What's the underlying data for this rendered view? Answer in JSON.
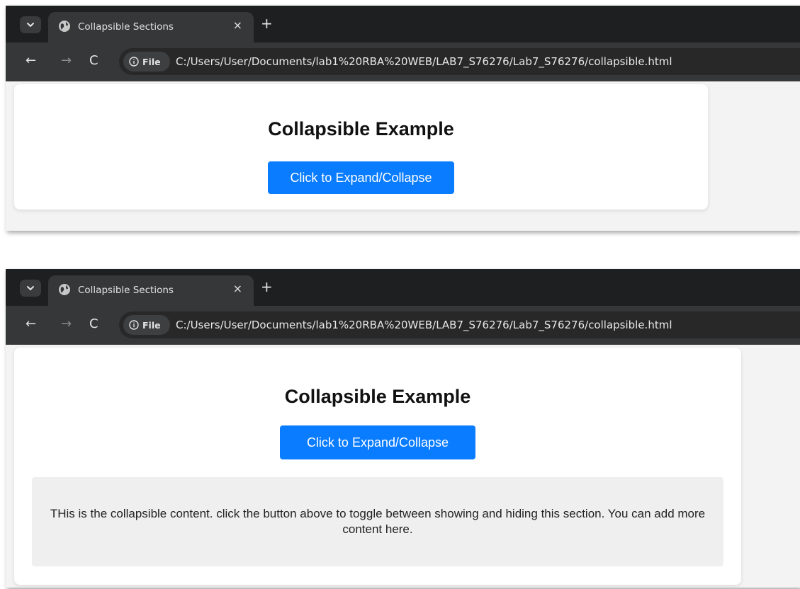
{
  "browser": {
    "tab_title": "Collapsible Sections",
    "tab_close": "×",
    "new_tab": "+",
    "nav_back": "←",
    "nav_forward": "→",
    "nav_reload": "C",
    "file_chip": "File",
    "url": "C:/Users/User/Documents/lab1%20RBA%20WEB/LAB7_S76276/Lab7_S76276/collapsible.html"
  },
  "page": {
    "heading": "Collapsible Example",
    "button_label": "Click to Expand/Collapse",
    "content_text": "THis is the collapsible content. click the button above to toggle between showing and hiding this section. You can add more content here."
  },
  "colors": {
    "accent": "#0a7cff",
    "tabbar": "#1e1f20",
    "toolbar": "#363738"
  }
}
